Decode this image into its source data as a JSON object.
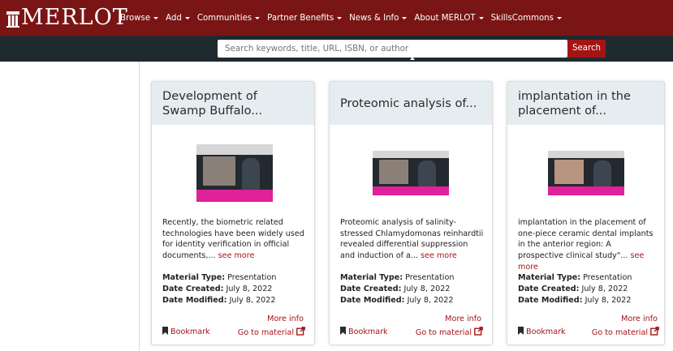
{
  "header": {
    "logo_text": "MERLOT",
    "nav": [
      {
        "label": "Browse",
        "caret": true
      },
      {
        "label": "Add",
        "caret": true
      },
      {
        "label": "Communities",
        "caret": true
      },
      {
        "label": "Partner Benefits",
        "caret": true
      },
      {
        "label": "News & Info",
        "caret": true
      },
      {
        "label": "About MERLOT",
        "caret": true
      },
      {
        "label": "SkillsCommons",
        "caret": true
      }
    ]
  },
  "search": {
    "placeholder": "Search keywords, title, URL, ISBN, or author",
    "button_label": "Search"
  },
  "labels": {
    "material_type": "Material Type:",
    "date_created": "Date Created:",
    "date_modified": "Date Modified:",
    "more_info": "More info",
    "bookmark": "Bookmark",
    "go_to_material": "Go to material",
    "see_more": "see more"
  },
  "cards": [
    {
      "title": "Development of Swamp Buffalo...",
      "description": "Recently, the biometric related technologies have been widely used for identity verification in official documents,...",
      "material_type": "Presentation",
      "date_created": "July 8, 2022",
      "date_modified": "July 8, 2022"
    },
    {
      "title": "Proteomic analysis of...",
      "description": "Proteomic analysis of salinity-stressed Chlamydomonas reinhardtii revealed differential suppression and induction of a...",
      "material_type": "Presentation",
      "date_created": "July 8, 2022",
      "date_modified": "July 8, 2022"
    },
    {
      "title": "implantation in the placement of...",
      "description": "implantation in the placement of one-piece ceramic dental implants in the anterior region: A prospective clinical study\"...",
      "material_type": "Presentation",
      "date_created": "July 8, 2022",
      "date_modified": "July 8, 2022"
    }
  ],
  "colors": {
    "brand": "#7a1515",
    "search_bar": "#1f2a2f",
    "accent": "#a51414",
    "card_header": "#e6edf1"
  },
  "icons": {
    "bookmark": "bookmark-icon",
    "external_link": "external-link-icon",
    "caret": "caret-down-icon"
  }
}
